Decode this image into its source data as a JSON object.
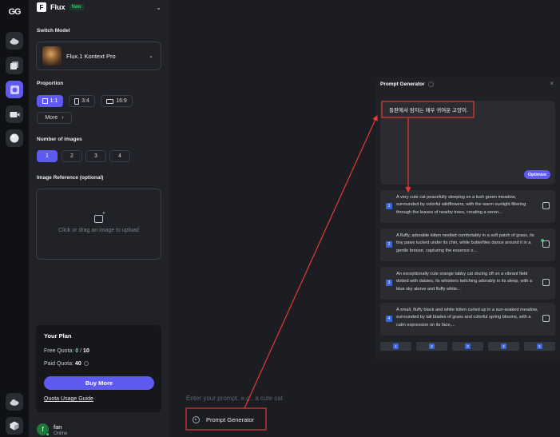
{
  "rail": {
    "logo": "GG",
    "items": [
      "cloud-icon",
      "image-stack-icon",
      "gallery-icon",
      "video-icon",
      "sphere-icon",
      "cloud-bottom-icon",
      "box-icon"
    ]
  },
  "brand": {
    "name": "Flux",
    "badge": "New",
    "mark": "F"
  },
  "switch_model": {
    "label": "Switch Model",
    "selected": "Flux.1 Kontext Pro"
  },
  "proportion": {
    "label": "Proportion",
    "options": [
      "1:1",
      "3:4",
      "16:9"
    ],
    "selected": "1:1",
    "more": "More",
    "more_chevron": "›"
  },
  "num_images": {
    "label": "Number of images",
    "options": [
      "1",
      "2",
      "3",
      "4"
    ],
    "selected": "1"
  },
  "image_reference": {
    "label": "Image Reference (optional)",
    "hint": "Click or drag an image to upload"
  },
  "plan": {
    "title": "Your Plan",
    "free_label": "Free Quota: ",
    "free_used": "0",
    "free_sep": " / ",
    "free_total": "10",
    "paid_label": "Paid Quota: ",
    "paid_value": "40",
    "buy_label": "Buy More",
    "guide_label": "Quota Usage Guide"
  },
  "user": {
    "initial": "f",
    "name": "fan",
    "status": "Online"
  },
  "prompt_generator": {
    "title": "Prompt Generator",
    "close": "×",
    "input_text": "들판에서 잠자는 매우 귀여운 고양이.",
    "optimize_label": "Optimize",
    "suggestions": [
      {
        "num": "1",
        "text": "A very cute cat peacefully sleeping on a lush green meadow, surrounded by colorful wildflowers, with the warm sunlight filtering through the leaves of nearby trees, creating a seren..."
      },
      {
        "num": "2",
        "text": "A fluffy, adorable kitten nestled comfortably in a soft patch of grass, its tiny paws tucked under its chin, while butterflies dance around it in a gentle breeze, capturing the essence o..."
      },
      {
        "num": "3",
        "text": "An exceptionally cute orange tabby cat dozing off on a vibrant field dotted with daisies, its whiskers twitching adorably in its sleep, with a blue sky above and fluffy white..."
      },
      {
        "num": "4",
        "text": "A small, fluffy black and white kitten curled up in a sun-soaked meadow, surrounded by tall blades of grass and colorful spring blooms, with a calm expression on its face,..."
      }
    ],
    "nav_buttons": [
      "1",
      "2",
      "3",
      "4",
      "5"
    ]
  },
  "composer": {
    "placeholder": "Enter your prompt, e.g., a cute cat",
    "prompt_generator_label": "Prompt Generator"
  },
  "colors": {
    "accent": "#5f5bf0",
    "annotation": "#e53935",
    "online": "#3ad46b"
  }
}
